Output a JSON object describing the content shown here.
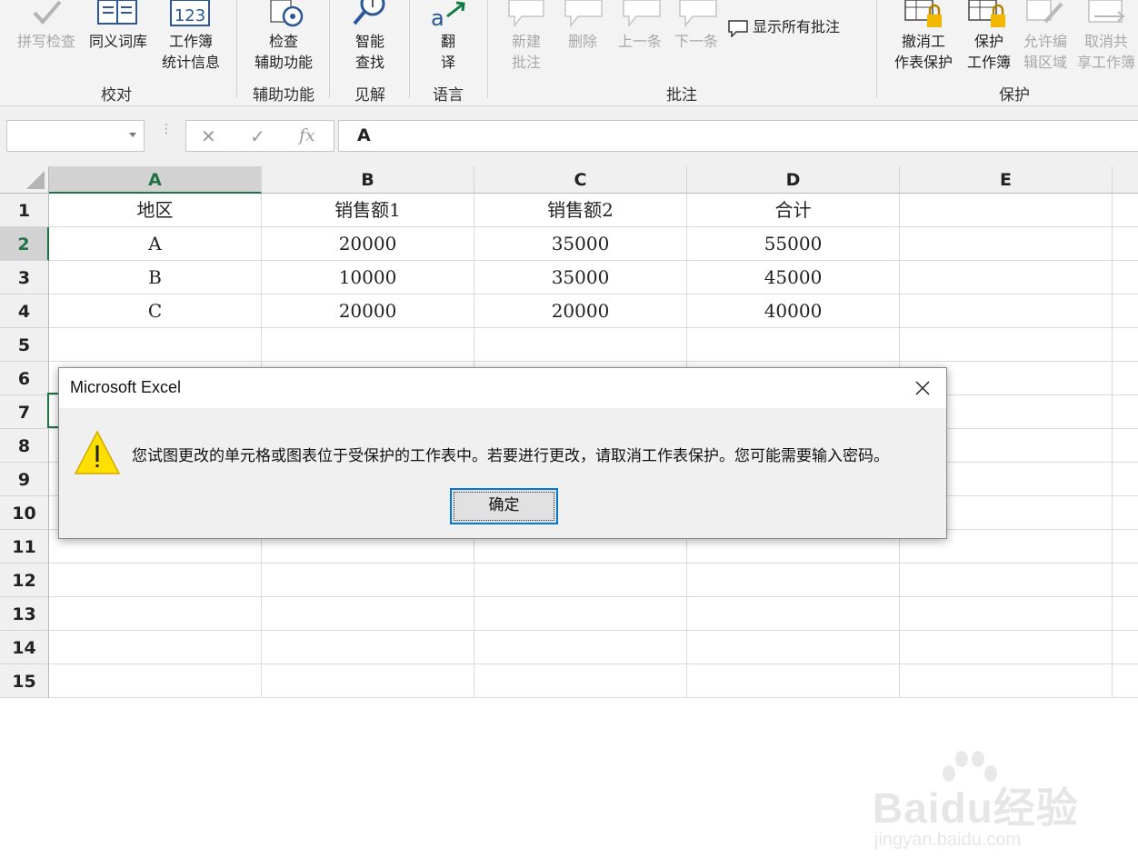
{
  "ribbon": {
    "buttons": [
      {
        "label": "拼写检查",
        "disabled": true,
        "icon": "spell-check-icon"
      },
      {
        "label": "同义词库",
        "disabled": false,
        "icon": "thesaurus-icon"
      },
      {
        "label": "工作簿\n统计信息",
        "disabled": false,
        "icon": "workbook-statistics-icon",
        "icon_text": "123"
      },
      {
        "label": "检查\n辅助功能",
        "disabled": false,
        "icon": "accessibility-check-icon"
      },
      {
        "label": "智能\n查找",
        "disabled": false,
        "icon": "smart-lookup-icon"
      },
      {
        "label": "翻\n译",
        "disabled": false,
        "icon": "translate-icon"
      },
      {
        "label": "新建\n批注",
        "disabled": true,
        "icon": "new-comment-icon"
      },
      {
        "label": "删除",
        "disabled": true,
        "icon": "delete-comment-icon"
      },
      {
        "label": "上一条",
        "disabled": true,
        "icon": "previous-comment-icon"
      },
      {
        "label": "下一条",
        "disabled": true,
        "icon": "next-comment-icon"
      },
      {
        "label": "显示所有批注",
        "disabled": false,
        "icon": "show-all-comments-icon"
      },
      {
        "label": "撤消工\n作表保护",
        "disabled": false,
        "icon": "unprotect-sheet-icon"
      },
      {
        "label": "保护\n工作簿",
        "disabled": false,
        "icon": "protect-workbook-icon"
      },
      {
        "label": "允许编\n辑区域",
        "disabled": true,
        "icon": "allow-edit-ranges-icon"
      },
      {
        "label": "取消共\n享工作簿",
        "disabled": true,
        "icon": "unshare-workbook-icon"
      }
    ],
    "groups": [
      "校对",
      "辅助功能",
      "见解",
      "语言",
      "批注",
      "保护"
    ]
  },
  "formula_bar": {
    "name_box": "",
    "cancel_icon": "✕",
    "enter_icon": "✓",
    "fx": "fx",
    "content": "A"
  },
  "sheet": {
    "columns": [
      "A",
      "B",
      "C",
      "D",
      "E"
    ],
    "rows": [
      "1",
      "2",
      "3",
      "4",
      "5",
      "6",
      "7",
      "8",
      "9",
      "10",
      "11",
      "12",
      "13",
      "14",
      "15"
    ],
    "cells": [
      [
        "地区",
        "销售额1",
        "销售额2",
        "合计",
        ""
      ],
      [
        "A",
        "20000",
        "35000",
        "55000",
        ""
      ],
      [
        "B",
        "10000",
        "35000",
        "45000",
        ""
      ],
      [
        "C",
        "20000",
        "20000",
        "40000",
        ""
      ]
    ],
    "selected_cell": "A2"
  },
  "dialog": {
    "title": "Microsoft Excel",
    "message": "您试图更改的单元格或图表位于受保护的工作表中。若要进行更改，请取消工作表保护。您可能需要输入密码。",
    "ok_label": "确定"
  },
  "watermark": {
    "brand": "Baidu经验",
    "url": "jingyan.baidu.com"
  }
}
